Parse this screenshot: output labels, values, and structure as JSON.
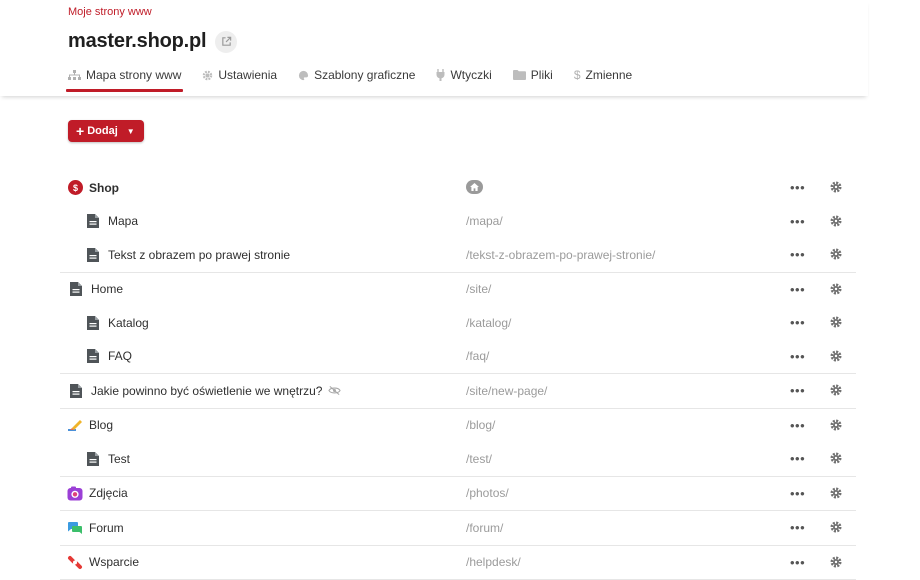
{
  "breadcrumb": "Moje strony www",
  "site_title": "master.shop.pl",
  "tabs": [
    {
      "label": "Mapa strony www",
      "icon": "sitemap-icon",
      "active": true
    },
    {
      "label": "Ustawienia",
      "icon": "gear-icon"
    },
    {
      "label": "Szablony graficzne",
      "icon": "palette-icon"
    },
    {
      "label": "Wtyczki",
      "icon": "plug-icon"
    },
    {
      "label": "Pliki",
      "icon": "folder-icon"
    },
    {
      "label": "Zmienne",
      "icon": "dollar-icon"
    }
  ],
  "add_button": {
    "label": "Dodaj"
  },
  "rows": [
    {
      "name": "Shop",
      "url": "",
      "icon": "shop-icon",
      "home": true
    },
    {
      "name": "Mapa",
      "url": "/mapa/",
      "icon": "page-icon"
    },
    {
      "name": "Tekst z obrazem po prawej stronie",
      "url": "/tekst-z-obrazem-po-prawej-stronie/",
      "icon": "page-icon"
    },
    {
      "name": "Home",
      "url": "/site/",
      "icon": "page-icon"
    },
    {
      "name": "Katalog",
      "url": "/katalog/",
      "icon": "page-icon"
    },
    {
      "name": "FAQ",
      "url": "/faq/",
      "icon": "page-icon"
    },
    {
      "name": "Jakie powinno być oświetlenie we wnętrzu?",
      "url": "/site/new-page/",
      "icon": "page-icon",
      "hidden": true
    },
    {
      "name": "Blog",
      "url": "/blog/",
      "icon": "blog-icon"
    },
    {
      "name": "Test",
      "url": "/test/",
      "icon": "page-icon"
    },
    {
      "name": "Zdjęcia",
      "url": "/photos/",
      "icon": "camera-icon"
    },
    {
      "name": "Forum",
      "url": "/forum/",
      "icon": "forum-icon"
    },
    {
      "name": "Wsparcie",
      "url": "/helpdesk/",
      "icon": "lifebuoy-icon"
    }
  ],
  "row_more_label": "•••",
  "colors": {
    "accent": "#c01c28"
  }
}
